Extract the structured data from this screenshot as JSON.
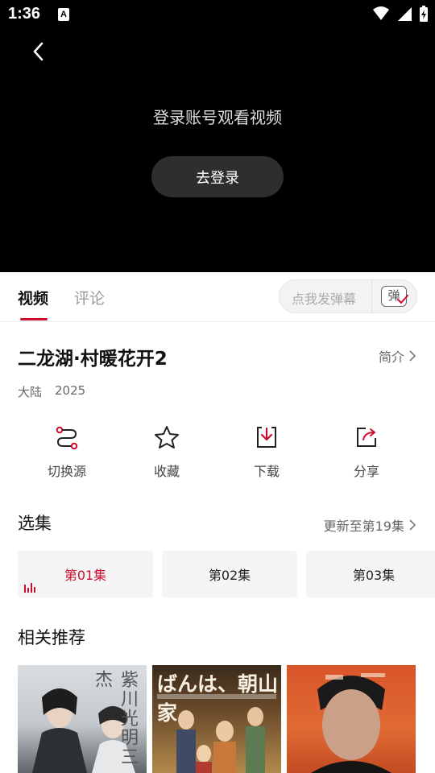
{
  "status_bar": {
    "time": "1:36",
    "notification_badge": "A",
    "icons": [
      "wifi-icon",
      "signal-icon",
      "battery-charging-icon"
    ]
  },
  "player": {
    "back_icon": "chevron-left-icon",
    "login_prompt": "登录账号观看视频",
    "login_button": "去登录"
  },
  "tabs": {
    "items": [
      {
        "label": "视频",
        "active": true
      },
      {
        "label": "评论",
        "active": false
      }
    ],
    "danmu_placeholder": "点我发弹幕",
    "danmu_icon_label": "弹"
  },
  "show": {
    "title": "二龙湖·村暖花开2",
    "intro_link": "简介",
    "region": "大陆",
    "year": "2025"
  },
  "actions": [
    {
      "label": "切换源",
      "icon": "switch-source-icon"
    },
    {
      "label": "收藏",
      "icon": "star-icon"
    },
    {
      "label": "下载",
      "icon": "download-icon"
    },
    {
      "label": "分享",
      "icon": "share-icon"
    }
  ],
  "episodes_section": {
    "title": "选集",
    "update_link": "更新至第19集",
    "episodes": [
      {
        "label": "第01集",
        "active": true
      },
      {
        "label": "第02集",
        "active": false
      },
      {
        "label": "第03集",
        "active": false
      }
    ]
  },
  "recommend_section": {
    "title": "相关推荐",
    "posters": [
      {
        "title": "紫川光明三杰"
      },
      {
        "title": "ばんは、朝山家"
      },
      {
        "title": ""
      }
    ]
  },
  "colors": {
    "accent": "#c8102e",
    "player_bg": "#000000",
    "login_button_bg": "#2e2e2e"
  }
}
